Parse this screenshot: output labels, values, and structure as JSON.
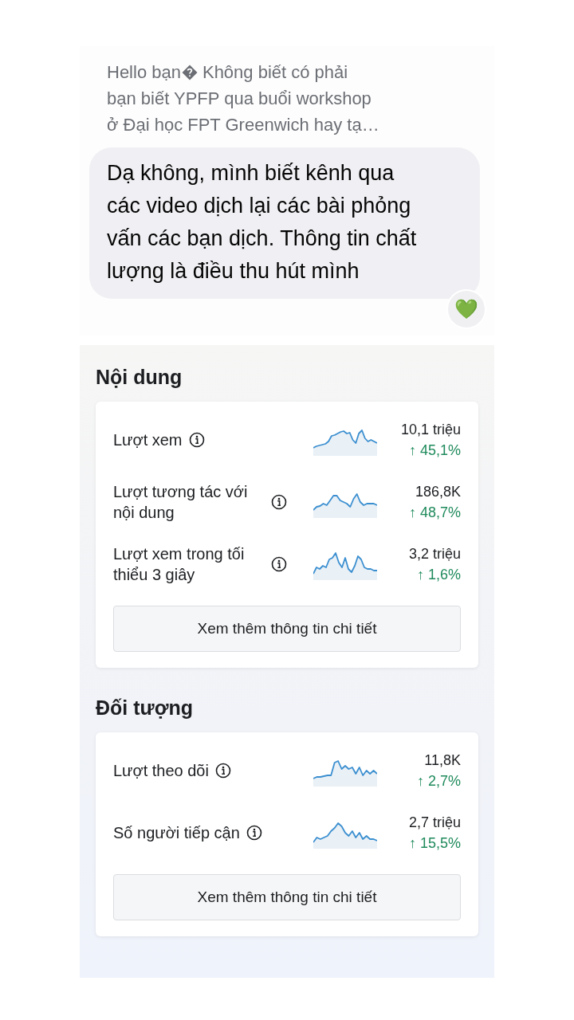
{
  "chat": {
    "reply_preview": {
      "start": "Hello bạn",
      "lines": [
        "Không biết có phải",
        "bạn biết YPFP qua buổi workshop",
        "ở Đại học FPT Greenwich hay tạ…"
      ]
    },
    "message": "Dạ không, mình biết kênh qua các video dịch lại các bài phỏng vấn các bạn dịch. Thông tin chất lượng là điều thu hút mình",
    "reaction": "💚"
  },
  "sections": [
    {
      "title": "Nội dung",
      "metrics": [
        {
          "label": "Lượt xem",
          "value": "10,1 triệu",
          "change": "↑ 45,1%"
        },
        {
          "label": "Lượt tương tác với nội dung",
          "value": "186,8K",
          "change": "↑ 48,7%"
        },
        {
          "label": "Lượt xem trong tối thiểu 3 giây",
          "value": "3,2 triệu",
          "change": "↑ 1,6%"
        }
      ],
      "button": "Xem thêm thông tin chi tiết"
    },
    {
      "title": "Đối tượng",
      "metrics": [
        {
          "label": "Lượt theo dõi",
          "value": "11,8K",
          "change": "↑ 2,7%"
        },
        {
          "label": "Số người tiếp cận",
          "value": "2,7 triệu",
          "change": "↑ 15,5%"
        }
      ],
      "button": "Xem thêm thông tin chi tiết"
    }
  ]
}
